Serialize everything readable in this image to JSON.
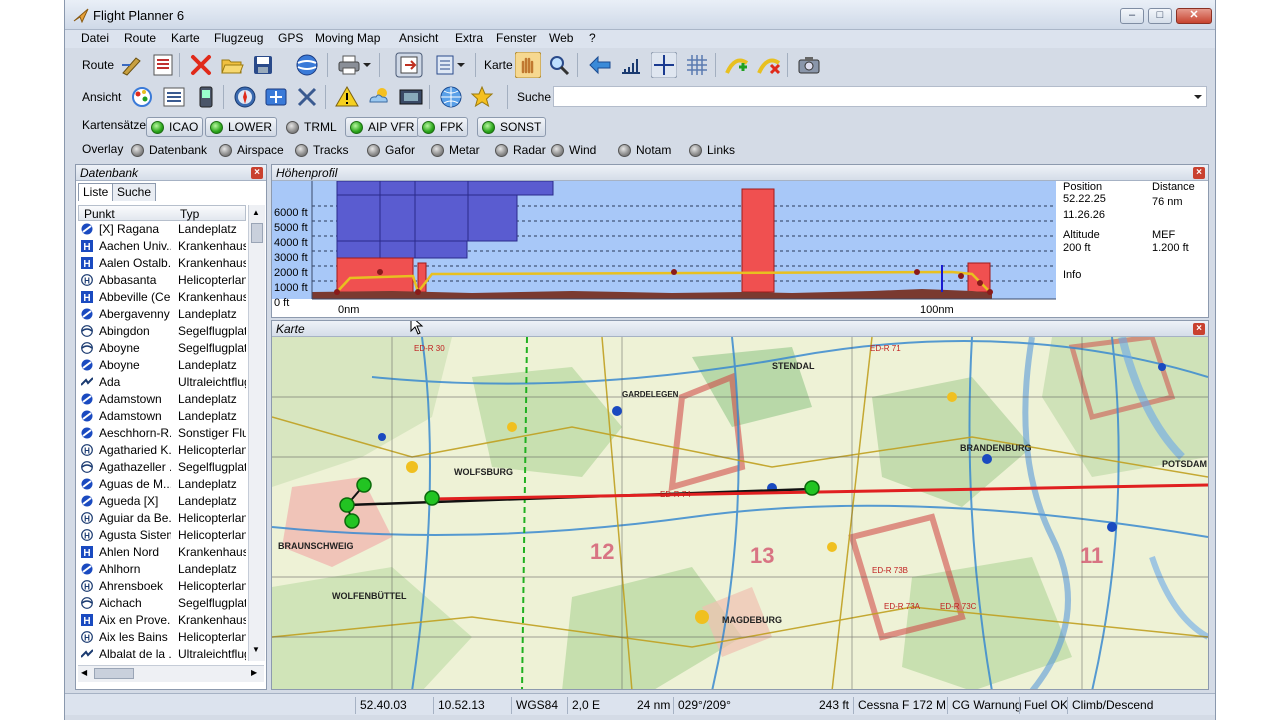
{
  "window": {
    "title": "Flight Planner 6"
  },
  "menu": [
    "Datei",
    "Route",
    "Karte",
    "Flugzeug",
    "GPS",
    "Moving Map",
    "Ansicht",
    "Extra",
    "Fenster",
    "Web",
    "?"
  ],
  "toolbar": {
    "route_label": "Route",
    "karte_label": "Karte",
    "ansicht_label": "Ansicht",
    "suche_label": "Suche",
    "suche_value": ""
  },
  "kartensaetze": {
    "label": "Kartensätze",
    "items": [
      {
        "label": "ICAO",
        "on": true
      },
      {
        "label": "LOWER",
        "on": true
      },
      {
        "label": "TRML",
        "on": false
      },
      {
        "label": "AIP VFR",
        "on": true
      },
      {
        "label": "FPK",
        "on": true
      },
      {
        "label": "SONST",
        "on": true
      }
    ]
  },
  "overlay": {
    "label": "Overlay",
    "items": [
      "Datenbank",
      "Airspace",
      "Tracks",
      "Gafor",
      "Metar",
      "Radar",
      "Wind",
      "Notam",
      "Links"
    ]
  },
  "datenbank": {
    "title": "Datenbank",
    "tabs": [
      "Liste",
      "Suche"
    ],
    "columns": [
      "Punkt",
      "Typ"
    ],
    "rows": [
      {
        "icon": "airfield-icon",
        "name": "[X] Ragana",
        "type": "Landeplatz"
      },
      {
        "icon": "hospital-icon",
        "name": "Aachen Univ...",
        "type": "Krankenhaus"
      },
      {
        "icon": "hospital-icon",
        "name": "Aalen Ostalb...",
        "type": "Krankenhaus"
      },
      {
        "icon": "heliport-icon",
        "name": "Abbasanta",
        "type": "Helicopterlanc"
      },
      {
        "icon": "hospital-icon",
        "name": "Abbeville (Ce...",
        "type": "Krankenhaus"
      },
      {
        "icon": "airfield-icon",
        "name": "Abergavenny",
        "type": "Landeplatz"
      },
      {
        "icon": "glider-icon",
        "name": "Abingdon",
        "type": "Segelflugplatz"
      },
      {
        "icon": "glider-icon",
        "name": "Aboyne",
        "type": "Segelflugplatz"
      },
      {
        "icon": "airfield-icon",
        "name": "Aboyne",
        "type": "Landeplatz"
      },
      {
        "icon": "ultralight-icon",
        "name": "Ada",
        "type": "Ultraleichtflugp"
      },
      {
        "icon": "airfield-icon",
        "name": "Adamstown",
        "type": "Landeplatz"
      },
      {
        "icon": "airfield-icon",
        "name": "Adamstown",
        "type": "Landeplatz"
      },
      {
        "icon": "airfield-icon",
        "name": "Aeschhorn-R...",
        "type": "Sonstiger Flug"
      },
      {
        "icon": "heliport-icon",
        "name": "Agatharied K...",
        "type": "Helicopterlanc"
      },
      {
        "icon": "glider-icon",
        "name": "Agathazeller ...",
        "type": "Segelflugplatz"
      },
      {
        "icon": "airfield-icon",
        "name": "Aguas de M...",
        "type": "Landeplatz"
      },
      {
        "icon": "airfield-icon",
        "name": "Agueda [X]",
        "type": "Landeplatz"
      },
      {
        "icon": "heliport-icon",
        "name": "Aguiar da Be...",
        "type": "Helicopterlanc"
      },
      {
        "icon": "heliport-icon",
        "name": "Agusta Sistemi",
        "type": "Helicopterlanc"
      },
      {
        "icon": "hospital-icon",
        "name": "Ahlen Nord",
        "type": "Krankenhaus"
      },
      {
        "icon": "airfield-icon",
        "name": "Ahlhorn",
        "type": "Landeplatz"
      },
      {
        "icon": "heliport-icon",
        "name": "Ahrensboek",
        "type": "Helicopterlanc"
      },
      {
        "icon": "glider-icon",
        "name": "Aichach",
        "type": "Segelflugplatz"
      },
      {
        "icon": "hospital-icon",
        "name": "Aix en Prove...",
        "type": "Krankenhaus"
      },
      {
        "icon": "heliport-icon",
        "name": "Aix les Bains ...",
        "type": "Helicopterlanc"
      },
      {
        "icon": "ultralight-icon",
        "name": "Albalat de la ...",
        "type": "Ultraleichtflugp"
      }
    ]
  },
  "hoehenprofil": {
    "title": "Höhenprofil",
    "y_ticks": [
      "6000 ft",
      "5000 ft",
      "4000 ft",
      "3000 ft",
      "2000 ft",
      "1000 ft",
      "0 ft"
    ],
    "x_labels": [
      "0nm",
      "100nm"
    ],
    "info": {
      "position_label": "Position",
      "position_lat": "52.22.25",
      "position_lon": "11.26.26",
      "distance_label": "Distance",
      "distance_value": "76 nm",
      "altitude_label": "Altitude",
      "altitude_value": "200 ft",
      "mef_label": "MEF",
      "mef_value": "1.200 ft",
      "info_label": "Info"
    }
  },
  "karte": {
    "title": "Karte",
    "places": [
      "WOLFSBURG",
      "BRAUNSCHWEIG",
      "MAGDEBURG",
      "BRANDENBURG",
      "POTSDAM",
      "STENDAL",
      "GARDELEGEN",
      "WOLFENBÜTTEL"
    ],
    "sectors": [
      "12",
      "13",
      "11"
    ],
    "zones": [
      "ED-R 74",
      "ED-R 73B",
      "ED-R 73A",
      "ED-R 73C",
      "ED-R 71",
      "ED-R 30"
    ]
  },
  "statusbar": [
    "52.40.03",
    "10.52.13",
    "WGS84",
    "2,0 E",
    "24 nm",
    "029°/209°",
    "243 ft",
    "Cessna F 172 M",
    "CG Warnung",
    "Fuel OK",
    "Climb/Descend"
  ],
  "colors": {
    "airspace_blue": "#5a5cd0",
    "restricted_red": "#f05050",
    "route_red": "#e02020",
    "waypoint_green": "#22c422"
  }
}
